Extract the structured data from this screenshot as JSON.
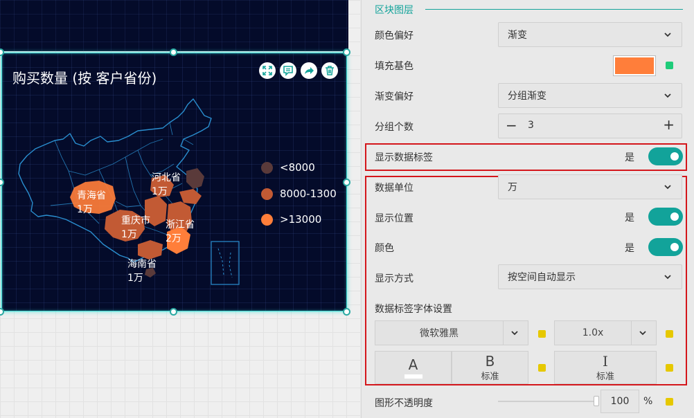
{
  "chart": {
    "title": "购买数量 (按 客户省份)",
    "legend": [
      {
        "label": "<8000",
        "color": "#5a3a3a"
      },
      {
        "label": "8000-1300",
        "color": "#c25a34"
      },
      {
        "label": ">13000",
        "color": "#ff7e3a"
      }
    ],
    "toolbar_icons": [
      "fullscreen-icon",
      "comment-icon",
      "share-icon",
      "trash-icon"
    ],
    "map_labels": [
      {
        "name": "河北省",
        "value": "1万"
      },
      {
        "name": "青海省",
        "value": "1万"
      },
      {
        "name": "重庆市",
        "value": "1万"
      },
      {
        "name": "浙江省",
        "value": "2万"
      },
      {
        "name": "海南省",
        "value": "1万"
      }
    ]
  },
  "chart_data": {
    "type": "other",
    "legend_buckets": [
      "<8000",
      "8000-1300",
      ">13000"
    ],
    "labeled_regions": [
      {
        "region": "河北省",
        "value_label": "1万"
      },
      {
        "region": "青海省",
        "value_label": "1万"
      },
      {
        "region": "重庆市",
        "value_label": "1万"
      },
      {
        "region": "浙江省",
        "value_label": "2万"
      },
      {
        "region": "海南省",
        "value_label": "1万"
      }
    ]
  },
  "panel": {
    "section_title": "区块图层",
    "color_pref": {
      "label": "颜色偏好",
      "value": "渐变"
    },
    "fill_base": {
      "label": "填充基色",
      "color": "#ff7e3a",
      "indicator_color": "#1fcc7a"
    },
    "gradient_pref": {
      "label": "渐变偏好",
      "value": "分组渐变"
    },
    "group_count": {
      "label": "分组个数",
      "minus": "−",
      "value": "3",
      "plus": "+"
    },
    "show_labels": {
      "label": "显示数据标签",
      "state": "是"
    },
    "data_unit": {
      "label": "数据单位",
      "value": "万"
    },
    "show_position": {
      "label": "显示位置",
      "state": "是"
    },
    "color": {
      "label": "颜色",
      "state": "是"
    },
    "display_mode": {
      "label": "显示方式",
      "value": "按空间自动显示"
    },
    "font_settings": {
      "label": "数据标签字体设置",
      "font": "微软雅黑",
      "scale": "1.0x",
      "font_color_glyph": "A",
      "bold_glyph": "B",
      "bold_label": "标准",
      "italic_glyph": "I",
      "italic_label": "标准",
      "indicator_color": "#e6c800"
    },
    "opacity": {
      "label": "图形不透明度",
      "value": "100",
      "unit": "%",
      "slider": 1.0
    }
  }
}
